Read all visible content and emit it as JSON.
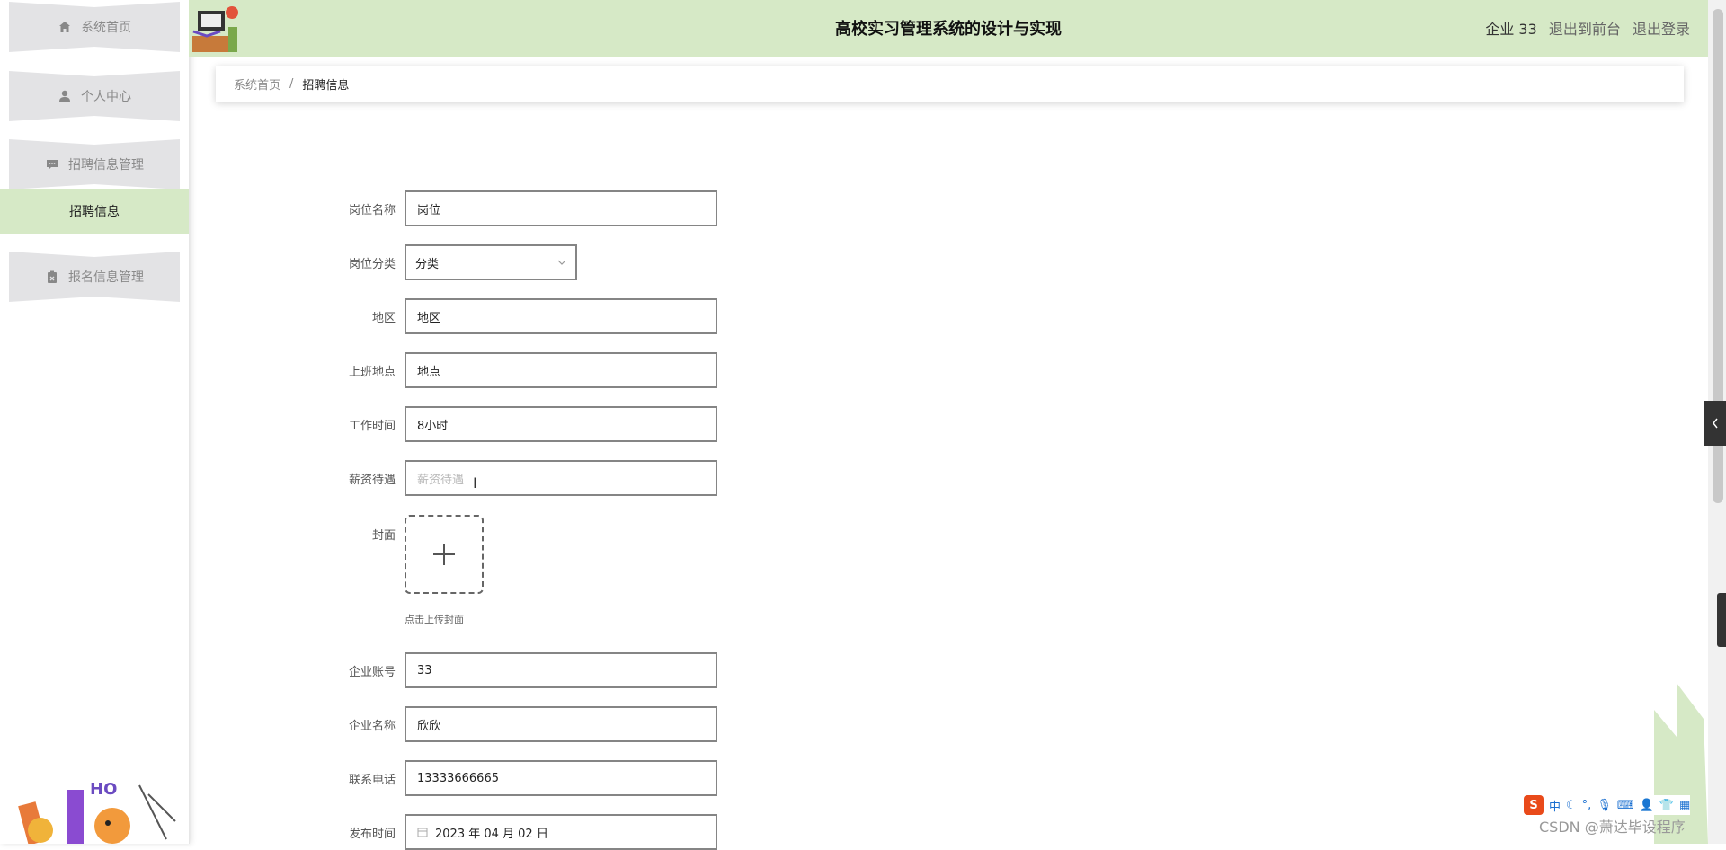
{
  "sidebar": {
    "items": [
      {
        "label": "系统首页",
        "icon": "home-icon"
      },
      {
        "label": "个人中心",
        "icon": "user-icon"
      },
      {
        "label": "招聘信息管理",
        "icon": "message-icon"
      },
      {
        "label": "报名信息管理",
        "icon": "clipboard-icon"
      }
    ],
    "active_sub": "招聘信息"
  },
  "header": {
    "title": "高校实习管理系统的设计与实现",
    "user": "企业 33",
    "to_front": "退出到前台",
    "logout": "退出登录"
  },
  "breadcrumb": {
    "home": "系统首页",
    "separator": "/",
    "current": "招聘信息"
  },
  "form": {
    "position_name": {
      "label": "岗位名称",
      "value": "岗位"
    },
    "category": {
      "label": "岗位分类",
      "value": "分类"
    },
    "region": {
      "label": "地区",
      "value": "地区"
    },
    "work_place": {
      "label": "上班地点",
      "value": "地点"
    },
    "work_time": {
      "label": "工作时间",
      "value": "8小时"
    },
    "salary": {
      "label": "薪资待遇",
      "placeholder": "薪资待遇"
    },
    "cover": {
      "label": "封面",
      "hint": "点击上传封面"
    },
    "company_account": {
      "label": "企业账号",
      "value": "33"
    },
    "company_name": {
      "label": "企业名称",
      "value": "欣欣"
    },
    "phone": {
      "label": "联系电话",
      "value": "13333666665"
    },
    "publish_time": {
      "label": "发布时间",
      "value": "2023 年 04 月 02 日"
    }
  },
  "overlay": {
    "ime_char": "中",
    "watermark": "CSDN @萧达毕设程序"
  },
  "colors": {
    "accent_green": "#d6e9c6",
    "menu_gray": "#e3e3e5"
  }
}
